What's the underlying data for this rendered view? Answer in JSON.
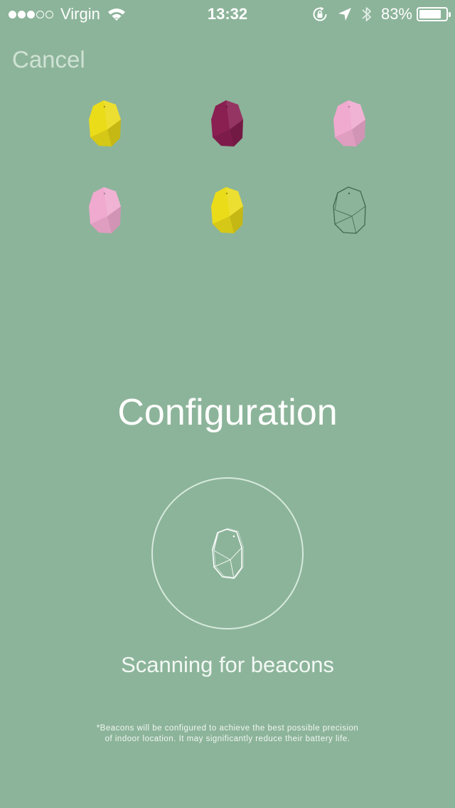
{
  "status_bar": {
    "signal_bars": 3,
    "signal_total": 5,
    "carrier": "Virgin",
    "time": "13:32",
    "battery_percent": "83%",
    "battery_level": 0.83
  },
  "nav": {
    "cancel_label": "Cancel"
  },
  "beacons": [
    {
      "color": "yellow"
    },
    {
      "color": "purple"
    },
    {
      "color": "pink"
    },
    {
      "color": "pink"
    },
    {
      "color": "yellow"
    },
    {
      "color": "outline"
    }
  ],
  "palette": {
    "background": "#8cb49a",
    "yellow": "#ebdc1a",
    "purple": "#8a1f52",
    "pink": "#f0a9cf"
  },
  "main": {
    "title": "Configuration",
    "status": "Scanning for beacons",
    "footnote_line1": "*Beacons will be configured to achieve the best possible precision",
    "footnote_line2": "of indoor location. It may significantly reduce their battery life."
  }
}
